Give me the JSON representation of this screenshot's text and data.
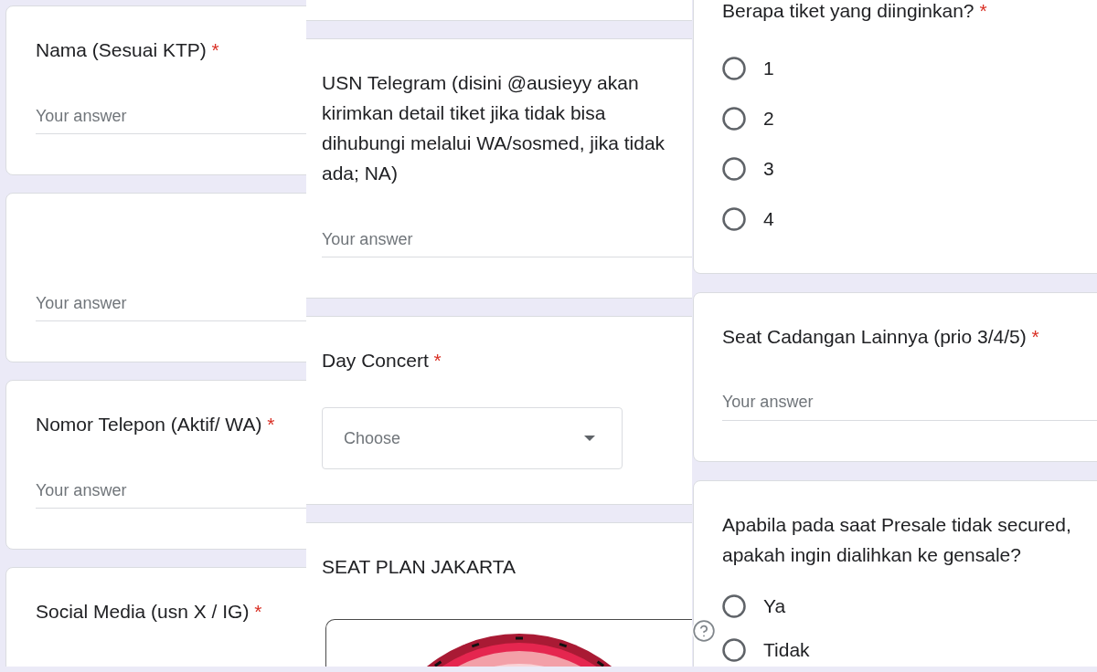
{
  "columns": [
    {
      "cards": [
        {
          "kind": "text",
          "title": "Nama (Sesuai KTP)",
          "required_mark": "*",
          "placeholder": "Your answer"
        },
        {
          "kind": "text",
          "placeholder": "Your answer"
        },
        {
          "kind": "text",
          "title": "Nomor Telepon (Aktif/ WA)",
          "required_mark": "*",
          "placeholder": "Your answer"
        },
        {
          "kind": "text",
          "title": "Social Media (usn X / IG)",
          "required_mark": "*"
        }
      ]
    },
    {
      "cards": [
        {
          "kind": "blank"
        },
        {
          "kind": "text",
          "title": "USN Telegram (disini @ausieyy akan kirimkan detail tiket jika tidak bisa dihubungi melalui WA/sosmed, jika tidak ada; NA)",
          "placeholder": "Your answer"
        },
        {
          "kind": "dropdown",
          "title": "Day Concert",
          "required_mark": "*",
          "placeholder": "Choose"
        },
        {
          "kind": "image",
          "title": "SEAT PLAN JAKARTA"
        }
      ]
    },
    {
      "cards": [
        {
          "kind": "radio",
          "title": "Berapa tiket yang diinginkan?",
          "required_mark": "*",
          "options": [
            {
              "label": "1",
              "selected": false
            },
            {
              "label": "2",
              "selected": false
            },
            {
              "label": "3",
              "selected": false
            },
            {
              "label": "4",
              "selected": false
            }
          ]
        },
        {
          "kind": "text",
          "title": "Seat Cadangan Lainnya (prio 3/4/5)",
          "required_mark": "*",
          "placeholder": "Your answer"
        },
        {
          "kind": "radio",
          "title": "Apabila pada saat Presale tidak secured, apakah ingin dialihkan ke gensale?",
          "options": [
            {
              "label": "Ya",
              "selected": false
            },
            {
              "label": "Tidak",
              "selected": false
            }
          ]
        }
      ]
    }
  ]
}
